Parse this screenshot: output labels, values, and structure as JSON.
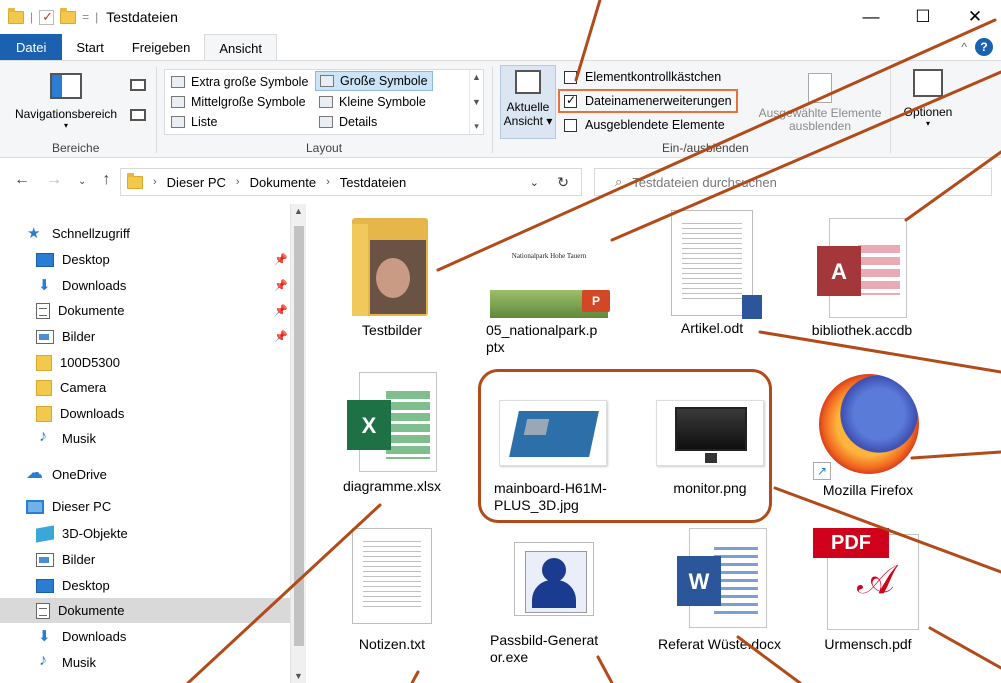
{
  "window": {
    "title": "Testdateien",
    "qat_separator": "|",
    "qat_dropdown": "=",
    "minimize": "—",
    "maximize": "☐",
    "close": "✕"
  },
  "ribbon_tabs": [
    "Datei",
    "Start",
    "Freigeben",
    "Ansicht"
  ],
  "ribbon_help": "?",
  "ribbon_collapse": "^",
  "ribbon": {
    "bereiche": {
      "group_label": "Bereiche",
      "navigationsbereich": "Navigationsbereich"
    },
    "layout": {
      "group_label": "Layout",
      "items": [
        "Extra große Symbole",
        "Große Symbole",
        "Mittelgroße Symbole",
        "Kleine Symbole",
        "Liste",
        "Details"
      ],
      "selected": "Große Symbole"
    },
    "aktuelle_ansicht": "Aktuelle Ansicht ▾",
    "ein_ausblenden": {
      "group_label": "Ein-/ausblenden",
      "checkboxes": [
        {
          "label": "Elementkontrollkästchen",
          "checked": false
        },
        {
          "label": "Dateinamenerweiterungen",
          "checked": true
        },
        {
          "label": "Ausgeblendete Elemente",
          "checked": false
        }
      ],
      "ausgewaehlte": "Ausgewählte Elemente ausblenden"
    },
    "optionen": "Optionen"
  },
  "address": {
    "breadcrumb": [
      "Dieser PC",
      "Dokumente",
      "Testdateien"
    ],
    "search_placeholder": "Testdateien durchsuchen"
  },
  "sidebar": {
    "items": [
      {
        "label": "Schnellzugriff",
        "icon": "star-icon"
      },
      {
        "label": "Desktop",
        "icon": "desktop-icon",
        "pinned": true
      },
      {
        "label": "Downloads",
        "icon": "download-icon",
        "pinned": true
      },
      {
        "label": "Dokumente",
        "icon": "document-icon",
        "pinned": true
      },
      {
        "label": "Bilder",
        "icon": "pictures-icon",
        "pinned": true
      },
      {
        "label": "100D5300",
        "icon": "folder-icon"
      },
      {
        "label": "Camera",
        "icon": "folder-icon"
      },
      {
        "label": "Downloads",
        "icon": "folder-icon"
      },
      {
        "label": "Musik",
        "icon": "music-icon"
      },
      {
        "label": "OneDrive",
        "icon": "cloud-icon"
      },
      {
        "label": "Dieser PC",
        "icon": "pc-icon"
      },
      {
        "label": "3D-Objekte",
        "icon": "cube-icon"
      },
      {
        "label": "Bilder",
        "icon": "pictures-icon"
      },
      {
        "label": "Desktop",
        "icon": "desktop-icon"
      },
      {
        "label": "Dokumente",
        "icon": "document-icon",
        "selected": true
      },
      {
        "label": "Downloads",
        "icon": "download-icon"
      },
      {
        "label": "Musik",
        "icon": "music-icon"
      }
    ]
  },
  "files": [
    {
      "name": "Testbilder",
      "type": "folder"
    },
    {
      "name": "05_nationalpark.pptx",
      "type": "pptx",
      "slide_text": "Nationalpark Hohe Tauern"
    },
    {
      "name": "Artikel.odt",
      "type": "odt"
    },
    {
      "name": "bibliothek.accdb",
      "type": "accdb"
    },
    {
      "name": "diagramme.xlsx",
      "type": "xlsx"
    },
    {
      "name": "mainboard-H61M-PLUS_3D.jpg",
      "type": "jpg"
    },
    {
      "name": "monitor.png",
      "type": "png"
    },
    {
      "name": "Mozilla Firefox",
      "type": "shortcut"
    },
    {
      "name": "Notizen.txt",
      "type": "txt"
    },
    {
      "name": "Passbild-Generator.exe",
      "type": "exe"
    },
    {
      "name": "Referat Wüste.docx",
      "type": "docx"
    },
    {
      "name": "Urmensch.pdf",
      "type": "pdf"
    }
  ],
  "badges": {
    "pptx": "P",
    "accdb": "A",
    "xlsx": "X",
    "docx": "W",
    "pdf": "PDF"
  },
  "colors": {
    "accent": "#1a62b0",
    "annotation": "#b24a1a",
    "highlight_box": "#e2733a"
  }
}
